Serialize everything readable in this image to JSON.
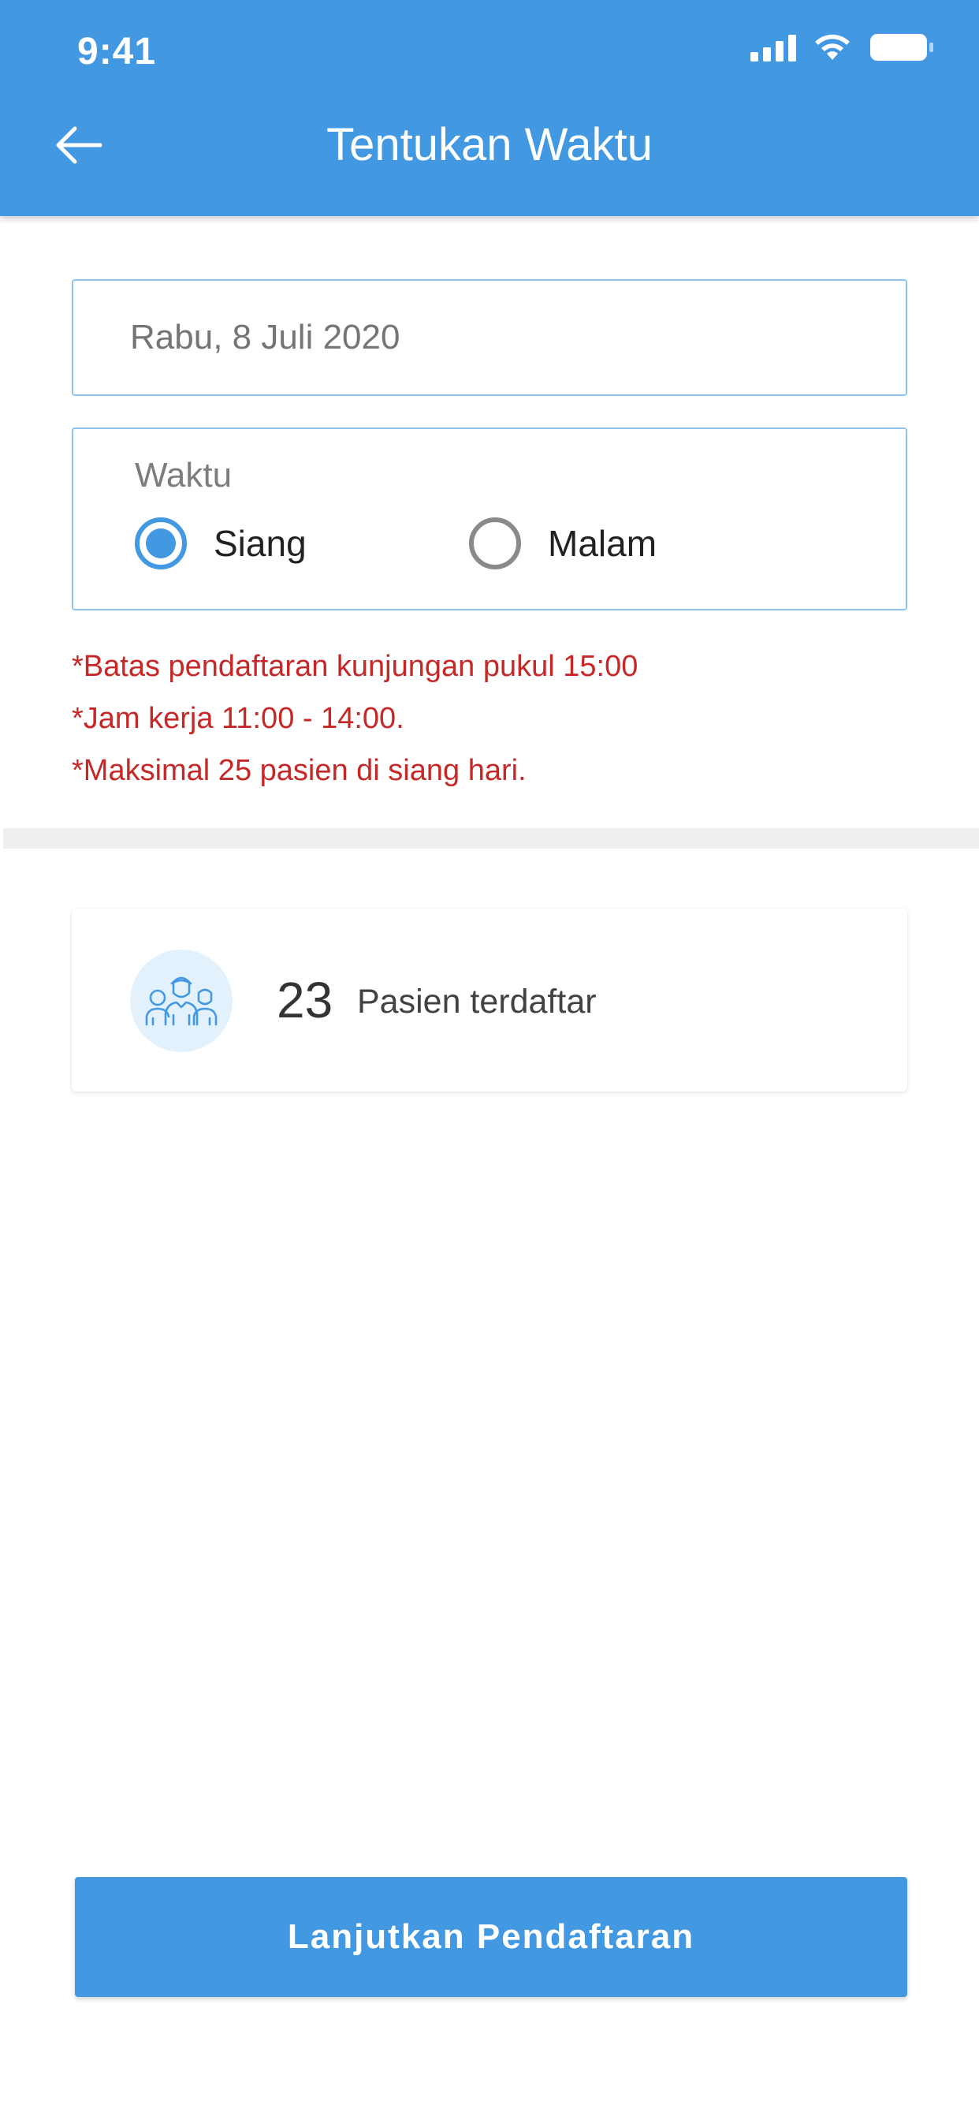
{
  "status_bar": {
    "time": "9:41",
    "icons": [
      "signal-icon",
      "wifi-icon",
      "battery-icon"
    ]
  },
  "header": {
    "title": "Tentukan Waktu",
    "back_icon": "arrow-left-icon",
    "background": "#4299e1"
  },
  "date_field": {
    "value": "Rabu, 8 Juli 2020"
  },
  "time_selector": {
    "label": "Waktu",
    "options": [
      {
        "label": "Siang",
        "selected": true
      },
      {
        "label": "Malam",
        "selected": false
      }
    ]
  },
  "notes": [
    "*Batas pendaftaran kunjungan pukul 15:00",
    "*Jam kerja 11:00 - 14:00.",
    "*Maksimal 25 pasien di siang hari."
  ],
  "patient_card": {
    "count": "23",
    "label": "Pasien terdaftar",
    "icon": "patients-group-icon"
  },
  "continue_button": {
    "label": "Lanjutkan Pendaftaran"
  },
  "colors": {
    "primary": "#4299e1",
    "warning_text": "#c62828",
    "field_border": "#90c2ea"
  }
}
